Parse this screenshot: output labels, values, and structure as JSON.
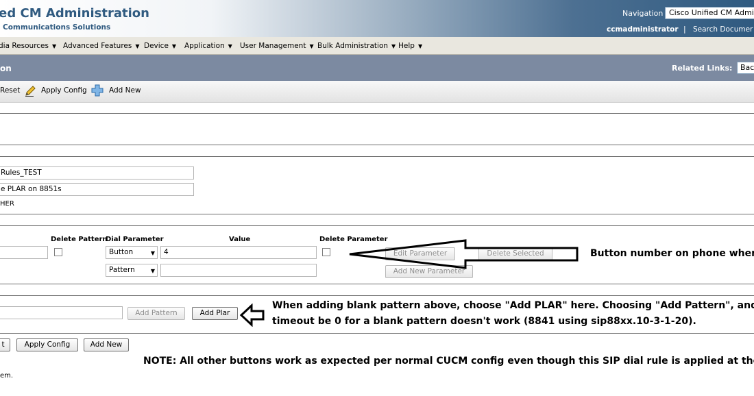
{
  "header": {
    "app_title": "ied CM Administration",
    "app_subtitle": "Communications Solutions",
    "navigation_label": "Navigation",
    "navigation_value": "Cisco Unified CM Admi",
    "user": "ccmadministrator",
    "separator": "|",
    "search_link": "Search Documer"
  },
  "menu": {
    "items": [
      {
        "label": "dia Resources"
      },
      {
        "label": "Advanced Features"
      },
      {
        "label": "Device"
      },
      {
        "label": "Application"
      },
      {
        "label": "User Management"
      },
      {
        "label": "Bulk Administration"
      },
      {
        "label": "Help"
      }
    ],
    "caret": "▼"
  },
  "title_bar": {
    "title": "on",
    "related_links_label": "Related Links:",
    "related_links_value": "Bac"
  },
  "toolbar": {
    "reset": "Reset",
    "apply_config": "Apply Config",
    "add_new": "Add New"
  },
  "info": {
    "name_value": "Rules_TEST",
    "description_value": "e PLAR on 8851s",
    "type_value": "HER"
  },
  "pattern": {
    "headers": {
      "delete_pattern": "Delete Pattern",
      "dial_parameter": "Dial Parameter",
      "value": "Value",
      "delete_parameter": "Delete Parameter"
    },
    "rows": [
      {
        "dial_parameter": "Button",
        "value": "4"
      },
      {
        "dial_parameter": "Pattern",
        "value": ""
      }
    ],
    "buttons": {
      "edit_parameter": "Edit Parameter",
      "delete_selected": "Delete Selected",
      "add_new_parameter": "Add New Parameter"
    }
  },
  "add_row": {
    "add_pattern": "Add Pattern",
    "add_plar": "Add Plar"
  },
  "bottom_buttons": {
    "reset": "t",
    "apply_config": "Apply Config",
    "add_new": "Add New"
  },
  "footer_text": "em.",
  "annotations": {
    "button_number": "Button number on phone wher",
    "plar_line1": "When adding blank pattern above, choose \"Add PLAR\" here.  Choosing \"Add Pattern\", and",
    "plar_line2": "timeout be 0 for a blank pattern doesn't work (8841 using sip88xx.10-3-1-20).",
    "note": "NOTE: All other buttons work as expected per normal CUCM config even though this SIP dial rule is applied at the"
  },
  "colors": {
    "brand": "#2f5a80",
    "title_bar": "#7c8aa1",
    "menu_bg": "#e9e7df"
  }
}
